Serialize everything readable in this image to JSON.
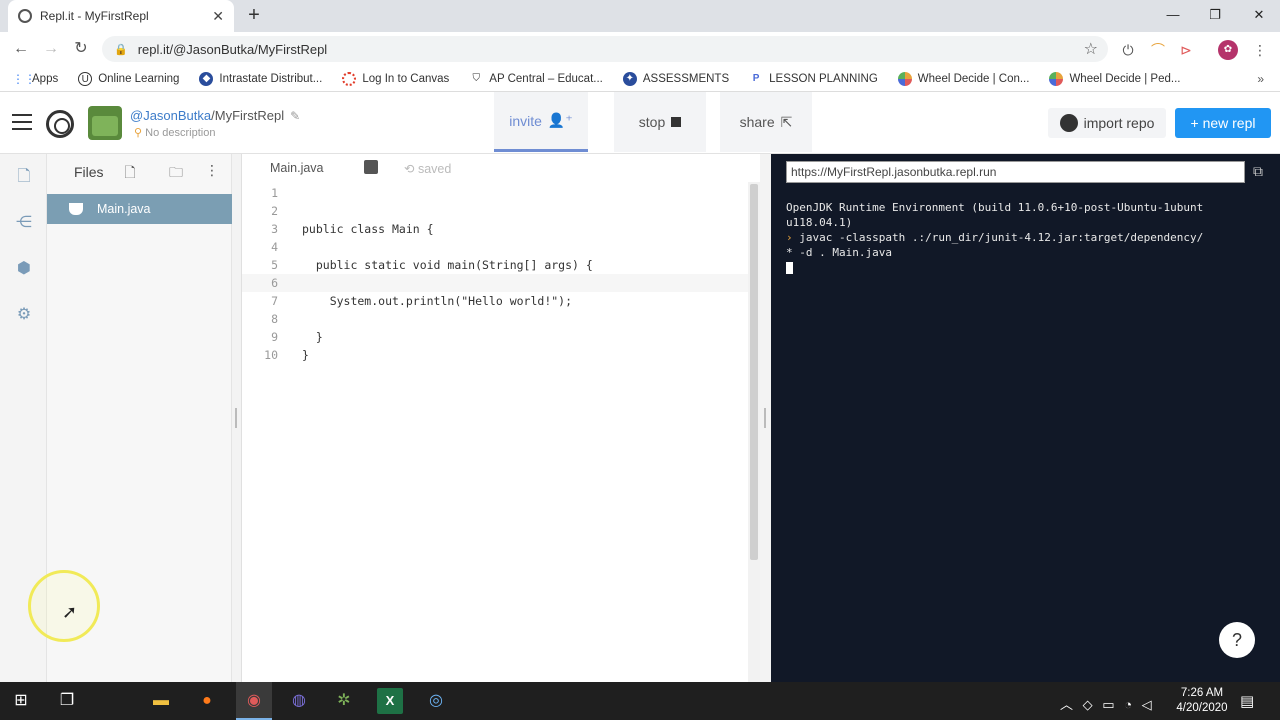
{
  "browser": {
    "tab_title": "Repl.it - MyFirstRepl",
    "tab_close": "✕",
    "new_tab": "+",
    "address": "repl.it/@JasonButka/MyFirstRepl",
    "bookmarks": [
      {
        "label": "Apps",
        "icon": "apps-grid-icon",
        "color": "#4285f4"
      },
      {
        "label": "Online Learning",
        "icon": "online-learning-icon",
        "color": "#333333"
      },
      {
        "label": "Intrastate Distribut...",
        "icon": "intrastate-icon",
        "color": "#2a4d9c"
      },
      {
        "label": "Log In to Canvas",
        "icon": "canvas-icon",
        "color": "#e13c2a"
      },
      {
        "label": "AP Central – Educat...",
        "icon": "ap-central-icon",
        "color": "#333333"
      },
      {
        "label": "ASSESSMENTS",
        "icon": "assessments-icon",
        "color": "#2a4d9c"
      },
      {
        "label": "LESSON PLANNING",
        "icon": "lesson-planning-icon",
        "color": "#4a6ad8"
      },
      {
        "label": "Wheel Decide | Con...",
        "icon": "wheel-decide-icon",
        "color": "#e8a33c"
      },
      {
        "label": "Wheel Decide | Ped...",
        "icon": "wheel-decide-icon-2",
        "color": "#e8a33c"
      }
    ],
    "bookmarks_more": "»"
  },
  "header": {
    "user": "@JasonButka",
    "project": "/MyFirstRepl",
    "description": "No description",
    "invite": "invite",
    "stop": "stop",
    "share": "share",
    "import_repo": "import repo",
    "new_repl": "+ new repl",
    "accent": "#6f8dd3",
    "new_repl_color": "#2196f3"
  },
  "files": {
    "title": "Files",
    "items": [
      {
        "name": "Main.java"
      }
    ]
  },
  "editor": {
    "tab_file": "Main.java",
    "status": "saved",
    "lines": [
      {
        "n": "1",
        "text": ""
      },
      {
        "n": "2",
        "text": ""
      },
      {
        "n": "3",
        "text": "public class Main {"
      },
      {
        "n": "4",
        "text": ""
      },
      {
        "n": "5",
        "text": "  public static void main(String[] args) {"
      },
      {
        "n": "6",
        "text": "    "
      },
      {
        "n": "7",
        "text": "    System.out.println(\"Hello world!\");"
      },
      {
        "n": "8",
        "text": ""
      },
      {
        "n": "9",
        "text": "  }"
      },
      {
        "n": "10",
        "text": "}"
      }
    ]
  },
  "console": {
    "url": "https://MyFirstRepl.jasonbutka.repl.run",
    "line1": "OpenJDK Runtime Environment (build 11.0.6+10-post-Ubuntu-1ubunt",
    "line2": "u118.04.1)",
    "prompt": "›",
    "line3": " javac -classpath .:/run_dir/junit-4.12.jar:target/dependency/",
    "line4": "* -d . Main.java",
    "help": "?"
  },
  "taskbar": {
    "time": "7:26 AM",
    "date": "4/20/2020"
  }
}
